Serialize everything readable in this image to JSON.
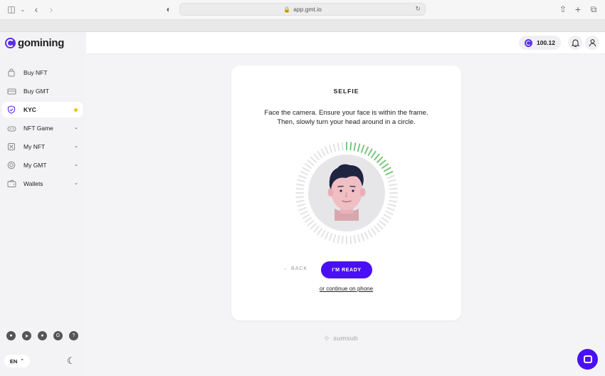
{
  "browser": {
    "url": "app.gmt.io"
  },
  "brand": {
    "name": "gomining",
    "accent": "#5b2ee8"
  },
  "sidebar": {
    "items": [
      {
        "label": "Buy NFT",
        "icon": "bag-icon",
        "has_chevron": false,
        "active": false
      },
      {
        "label": "Buy GMT",
        "icon": "card-icon",
        "has_chevron": false,
        "active": false
      },
      {
        "label": "KYC",
        "icon": "shield-check-icon",
        "has_chevron": false,
        "active": true,
        "badge": "yellow-dot"
      },
      {
        "label": "NFT Game",
        "icon": "gamepad-icon",
        "has_chevron": true,
        "active": false
      },
      {
        "label": "My NFT",
        "icon": "cube-icon",
        "has_chevron": true,
        "active": false
      },
      {
        "label": "My GMT",
        "icon": "coin-icon",
        "has_chevron": true,
        "active": false
      },
      {
        "label": "Wallets",
        "icon": "wallet-icon",
        "has_chevron": true,
        "active": false
      }
    ],
    "socials": [
      "discord-icon",
      "telegram-icon",
      "twitter-icon",
      "gomining-icon",
      "help-icon"
    ],
    "language": "EN"
  },
  "header": {
    "balance": "100.12"
  },
  "kyc": {
    "title": "SELFIE",
    "instructions_line1": "Face the camera. Ensure your face is within the frame.",
    "instructions_line2": "Then, slowly turn your head around in a circle.",
    "back_label": "← BACK",
    "ready_label": "I'M READY",
    "phone_link": "or continue on phone",
    "progress_color": "#7cc47f"
  },
  "footer": {
    "provider": "sumsub"
  }
}
